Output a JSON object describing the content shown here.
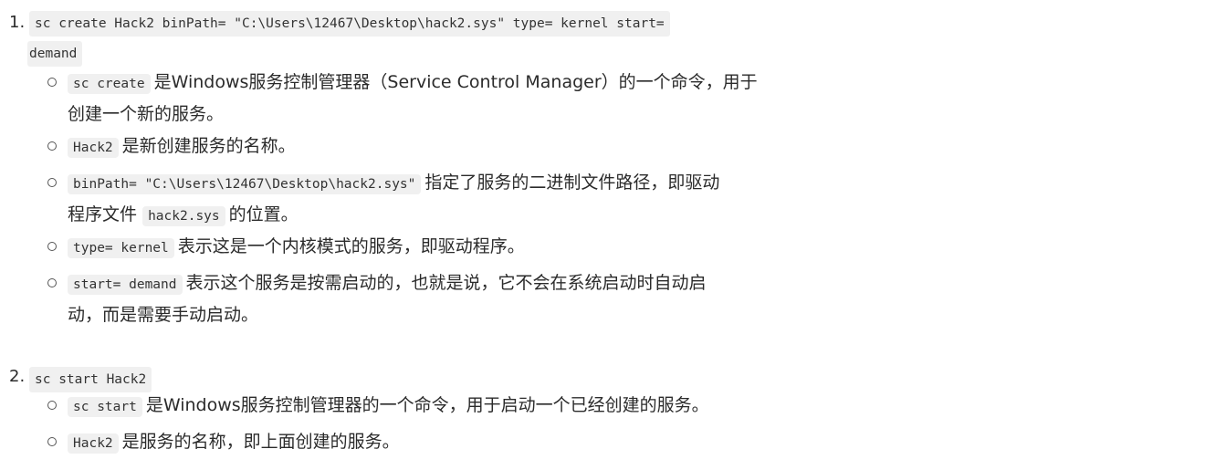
{
  "items": [
    {
      "number": "1.",
      "command_line1": "sc create Hack2 binPath= \"C:\\Users\\12467\\Desktop\\hack2.sys\" type= kernel start=",
      "command_line2": "demand",
      "bullets": [
        {
          "code": "sc create",
          "text": "是Windows服务控制管理器（Service Control Manager）的一个命令，用于",
          "text2": "创建一个新的服务。"
        },
        {
          "code": "Hack2",
          "text": "是新创建服务的名称。"
        },
        {
          "code": "binPath= \"C:\\Users\\12467\\Desktop\\hack2.sys\"",
          "text": "指定了服务的二进制文件路径，即驱动",
          "text2_pre": "程序文件",
          "code2": "hack2.sys",
          "text2_post": "的位置。"
        },
        {
          "code": "type= kernel",
          "text": "表示这是一个内核模式的服务，即驱动程序。"
        },
        {
          "code": "start= demand",
          "text": "表示这个服务是按需启动的，也就是说，它不会在系统启动时自动启",
          "text2": "动，而是需要手动启动。"
        }
      ]
    },
    {
      "number": "2.",
      "command_line1": "sc start Hack2",
      "bullets": [
        {
          "code": "sc start",
          "text": "是Windows服务控制管理器的一个命令，用于启动一个已经创建的服务。"
        },
        {
          "code": "Hack2",
          "text": "是服务的名称，即上面创建的服务。"
        }
      ]
    }
  ]
}
